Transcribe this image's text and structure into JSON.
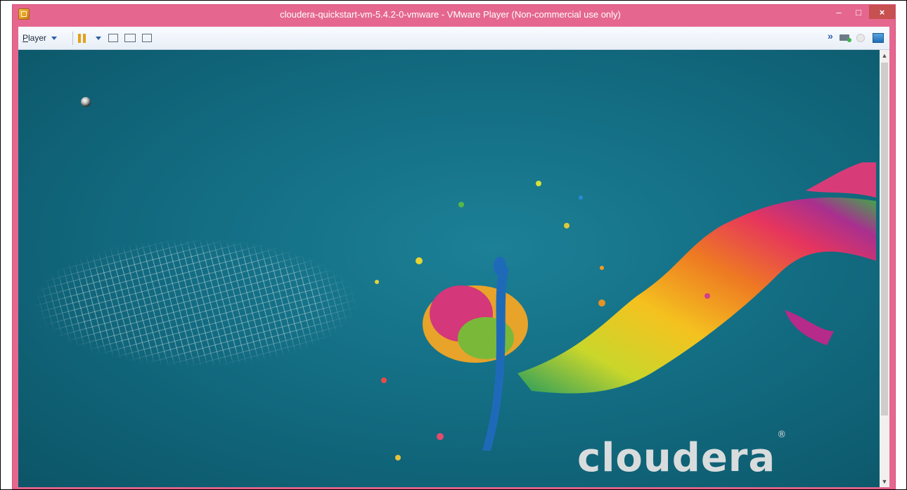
{
  "window": {
    "title": "cloudera-quickstart-vm-5.4.2-0-vmware - VMware Player (Non-commercial use only)",
    "controls": {
      "minimize": "–",
      "maximize": "□",
      "close": "×"
    }
  },
  "toolbar": {
    "player_menu": {
      "mnemonic": "P",
      "rest": "layer"
    },
    "icons": [
      "pause-icon",
      "send-ctrl-alt-del-icon",
      "fit-guest-icon",
      "unity-icon",
      "chevron-right-icon",
      "hard-disk-icon",
      "cd-dvd-icon",
      "network-adapter-icon"
    ],
    "chevron": "»"
  },
  "desktop": {
    "logo_text": "cloudera",
    "logo_mark": "®",
    "background_color": "#136d83"
  },
  "scrollbar": {
    "up": "▲",
    "down": "▼"
  }
}
